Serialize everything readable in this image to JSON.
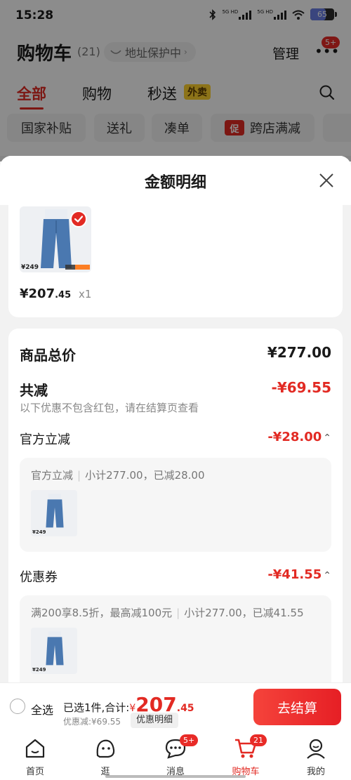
{
  "status_bar": {
    "time": "15:28",
    "battery": "65",
    "signal_labels": [
      "5G HD",
      "5G HD"
    ]
  },
  "header": {
    "title": "购物车",
    "count": "(21)",
    "address_protect": "地址保护中",
    "manage": "管理",
    "more_badge": "5+"
  },
  "tabs": [
    {
      "label": "全部",
      "active": true
    },
    {
      "label": "购物",
      "active": false
    },
    {
      "label": "秒送",
      "active": false
    }
  ],
  "takeout_tag": "外卖",
  "chips": [
    {
      "label": "国家补贴"
    },
    {
      "label": "送礼"
    },
    {
      "label": "凑单"
    },
    {
      "label": "跨店满减",
      "promo_icon": "促"
    }
  ],
  "sheet": {
    "title": "金额明细",
    "item": {
      "price_int": "¥207",
      "price_dec": ".45",
      "qty": "x1",
      "thumb_price": "¥249"
    },
    "total_label": "商品总价",
    "total_value": "¥277.00",
    "reduce_label": "共减",
    "reduce_value": "-¥69.55",
    "reduce_note": "以下优惠不包含红包，请在结算页查看",
    "official": {
      "label": "官方立减",
      "value": "-¥28.00",
      "detail_a": "官方立减",
      "detail_b": "小计277.00，已减28.00"
    },
    "coupon": {
      "label": "优惠券",
      "value": "-¥41.55",
      "detail_a": "满200享8.5折，最高减100元",
      "detail_b": "小计277.00，已减41.55"
    }
  },
  "checkout": {
    "select_all": "全选",
    "selected_text": "已选1件,合计:",
    "currency": "¥",
    "total_int": "207",
    "total_dec": ".45",
    "discount": "优惠减:¥69.55",
    "detail_button": "优惠明细",
    "checkout_button": "去结算"
  },
  "nav": [
    {
      "label": "首页",
      "icon": "home-icon"
    },
    {
      "label": "逛",
      "icon": "browse-icon"
    },
    {
      "label": "消息",
      "icon": "message-icon",
      "badge": "5+"
    },
    {
      "label": "购物车",
      "icon": "cart-icon",
      "badge": "21",
      "active": true
    },
    {
      "label": "我的",
      "icon": "profile-icon"
    }
  ],
  "colors": {
    "accent": "#e22a23",
    "promo_yellow": "#ffd22e",
    "battery_fill": "#6b7fe6"
  }
}
